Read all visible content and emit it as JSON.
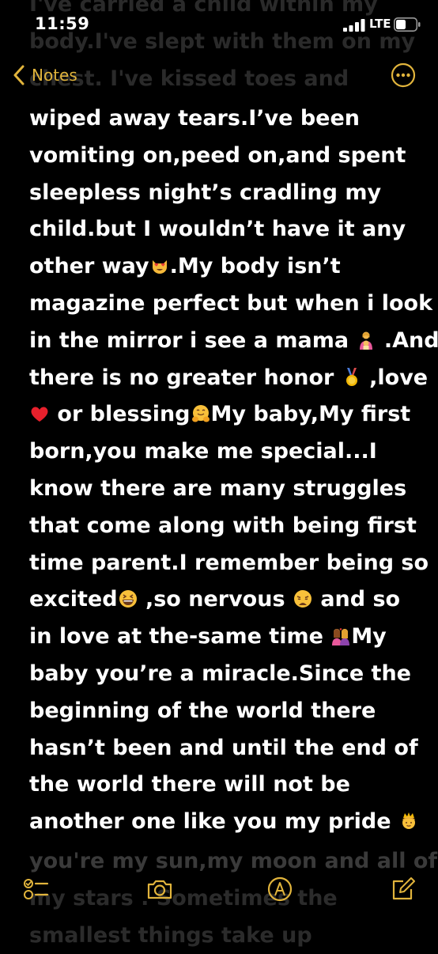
{
  "status_bar": {
    "time": "11:59",
    "network": "LTE"
  },
  "nav": {
    "back_label": "Notes",
    "accent_color": "#e1b43c"
  },
  "scrolled_above": [
    "I've carried a child within my",
    "body.I've slept with them on my",
    "chest. I've kissed  toes and"
  ],
  "note": {
    "lines": [
      {
        "segments": [
          "wiped away tears.I’ve been"
        ]
      },
      {
        "segments": [
          "vomiting on,peed on,and spent"
        ]
      },
      {
        "segments": [
          "sleepless night’s cradling my"
        ]
      },
      {
        "segments": [
          "child.but I wouldn’t have it any"
        ]
      },
      {
        "segments": [
          "other way",
          ".My body isn’t"
        ],
        "emoji": [
          "heart-eyes-cat-emoji"
        ]
      },
      {
        "segments": [
          "magazine perfect but when i look"
        ]
      },
      {
        "segments": [
          "in the mirror i see a mama ",
          " .And"
        ],
        "emoji": [
          "mother-baby-emoji"
        ]
      },
      {
        "segments": [
          "there is no greater honor ",
          " ,love"
        ],
        "emoji": [
          "medal-emoji"
        ]
      },
      {
        "segments": [
          "",
          " or blessing",
          "My baby,My first"
        ],
        "emoji": [
          "red-heart-emoji",
          "hugging-face-emoji"
        ]
      },
      {
        "segments": [
          "born,you make me special...I"
        ]
      },
      {
        "segments": [
          "know there are many struggles"
        ]
      },
      {
        "segments": [
          "that come along with being first"
        ]
      },
      {
        "segments": [
          "time parent.I remember being so"
        ]
      },
      {
        "segments": [
          "excited",
          " ,so nervous ",
          " and so"
        ],
        "emoji": [
          "grinning-squint-emoji",
          "weary-face-emoji"
        ]
      },
      {
        "segments": [
          "in love at the-same time ",
          "My"
        ],
        "emoji": [
          "couple-kiss-emoji"
        ]
      },
      {
        "segments": [
          "baby you’re a miracle.Since the"
        ]
      },
      {
        "segments": [
          "beginning of the world there"
        ]
      },
      {
        "segments": [
          "hasn’t been and until the end of"
        ]
      },
      {
        "segments": [
          "the world there will not be"
        ]
      },
      {
        "segments": [
          "another one like you my pride ",
          ""
        ],
        "emoji": [
          "prince-emoji"
        ]
      }
    ]
  },
  "scrolled_below": [
    "you're my sun,my moon and all of",
    "my stars . Sometimes the",
    "smallest things take up"
  ],
  "toolbar": {
    "items": [
      "checklist-icon",
      "camera-icon",
      "markup-icon",
      "compose-icon"
    ]
  }
}
